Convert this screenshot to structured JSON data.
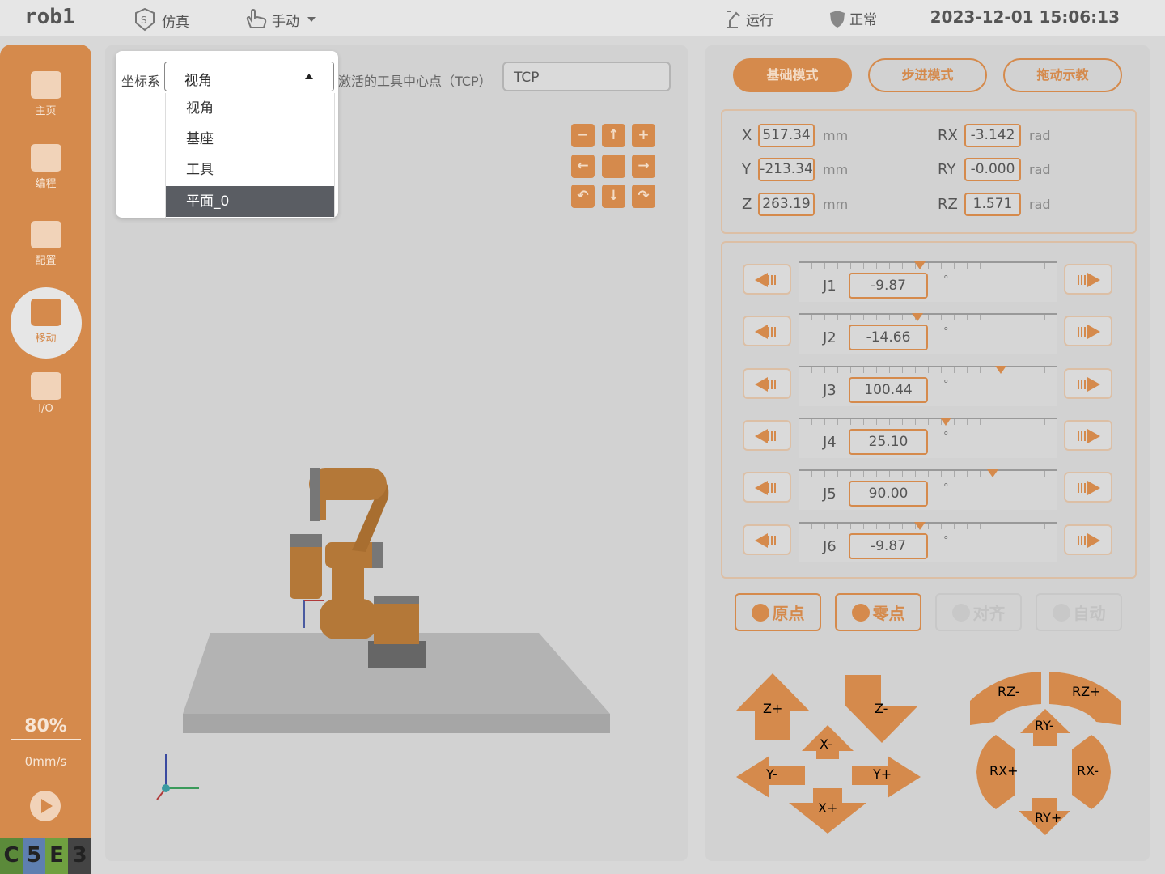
{
  "topbar": {
    "title": "rob1",
    "sim_label": "仿真",
    "mode_label": "手动",
    "run_label": "运行",
    "status_label": "正常",
    "datetime": "2023-12-01 15:06:13"
  },
  "sidebar": {
    "items": [
      {
        "label": "主页",
        "icon": "home-icon"
      },
      {
        "label": "编程",
        "icon": "code-icon"
      },
      {
        "label": "配置",
        "icon": "config-icon"
      },
      {
        "label": "移动",
        "icon": "move-icon"
      },
      {
        "label": "I/O",
        "icon": "io-icon"
      }
    ],
    "speed_percent": "80%",
    "velocity": "0mm/s",
    "logo_letters": [
      "C",
      "5",
      "E",
      "3"
    ]
  },
  "coordinate": {
    "label": "坐标系",
    "selected": "视角",
    "options": [
      "视角",
      "基座",
      "工具",
      "平面_0"
    ],
    "highlighted": "平面_0"
  },
  "tcp": {
    "label": "激活的工具中心点（TCP）",
    "value": "TCP"
  },
  "modes": {
    "basic": "基础模式",
    "step": "步进模式",
    "drag": "拖动示教",
    "active": "basic"
  },
  "pose": {
    "x": {
      "label": "X",
      "value": "517.34",
      "unit": "mm"
    },
    "y": {
      "label": "Y",
      "value": "-213.34",
      "unit": "mm"
    },
    "z": {
      "label": "Z",
      "value": "263.19",
      "unit": "mm"
    },
    "rx": {
      "label": "RX",
      "value": "-3.142",
      "unit": "rad"
    },
    "ry": {
      "label": "RY",
      "value": "-0.000",
      "unit": "rad"
    },
    "rz": {
      "label": "RZ",
      "value": "1.571",
      "unit": "rad"
    }
  },
  "joints": [
    {
      "name": "J1",
      "value": "-9.87",
      "unit": "°",
      "slider": 0.47
    },
    {
      "name": "J2",
      "value": "-14.66",
      "unit": "°",
      "slider": 0.46
    },
    {
      "name": "J3",
      "value": "100.44",
      "unit": "°",
      "slider": 0.78
    },
    {
      "name": "J4",
      "value": "25.10",
      "unit": "°",
      "slider": 0.57
    },
    {
      "name": "J5",
      "value": "90.00",
      "unit": "°",
      "slider": 0.75
    },
    {
      "name": "J6",
      "value": "-9.87",
      "unit": "°",
      "slider": 0.47
    }
  ],
  "actions": {
    "home": "原点",
    "zero": "零点",
    "align": "对齐",
    "auto": "自动"
  },
  "jog_cross": {
    "z_plus": "Z+",
    "z_minus": "Z-",
    "x_minus": "X-",
    "x_plus": "X+",
    "y_minus": "Y-",
    "y_plus": "Y+",
    "rz_minus": "RZ-",
    "rz_plus": "RZ+",
    "ry_minus": "RY-",
    "ry_plus": "RY+",
    "rx_plus": "RX+",
    "rx_minus": "RX-"
  },
  "colors": {
    "accent": "#d58a4c",
    "highlight_option": "#5a5d63"
  }
}
